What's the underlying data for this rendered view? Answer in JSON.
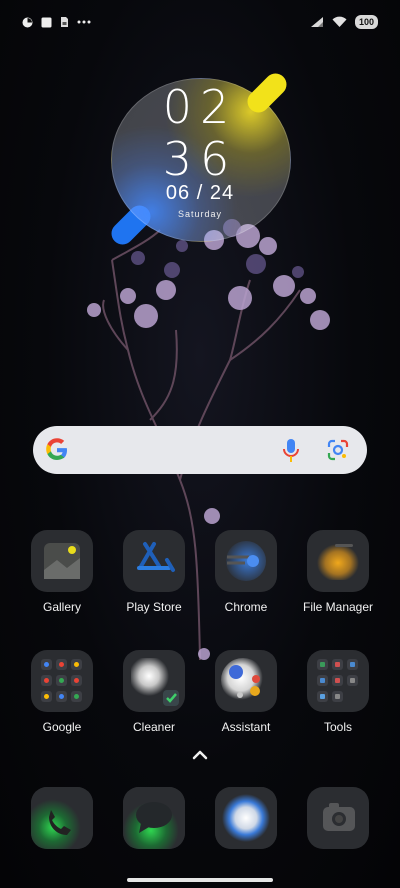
{
  "status_bar": {
    "battery_level": "100",
    "left_icons": [
      "app-notification-icon",
      "square-notification-icon",
      "sim-card-icon",
      "more-dots-icon"
    ],
    "right_icons": [
      "cellular-signal-icon",
      "wifi-icon",
      "battery-icon"
    ]
  },
  "clock": {
    "hours": "02",
    "minutes": "36",
    "date": "06 / 24",
    "day": "Saturday",
    "accent_yellow": "#f2e21a",
    "accent_blue": "#1f74f0"
  },
  "search": {
    "icons": [
      "google-logo-icon",
      "microphone-icon",
      "google-lens-icon"
    ]
  },
  "apps": [
    {
      "label": "Gallery",
      "icon": "gallery-icon"
    },
    {
      "label": "Play Store",
      "icon": "play-store-icon"
    },
    {
      "label": "Chrome",
      "icon": "chrome-icon"
    },
    {
      "label": "File Manager",
      "icon": "file-manager-icon"
    },
    {
      "label": "Google",
      "icon": "google-folder-icon"
    },
    {
      "label": "Cleaner",
      "icon": "cleaner-icon"
    },
    {
      "label": "Assistant",
      "icon": "assistant-icon"
    },
    {
      "label": "Tools",
      "icon": "tools-folder-icon"
    }
  ],
  "dock": [
    {
      "icon": "phone-icon"
    },
    {
      "icon": "messages-icon"
    },
    {
      "icon": "browser-icon"
    },
    {
      "icon": "camera-icon"
    }
  ],
  "gestures": {
    "app_drawer_icon": "chevron-up-icon"
  }
}
